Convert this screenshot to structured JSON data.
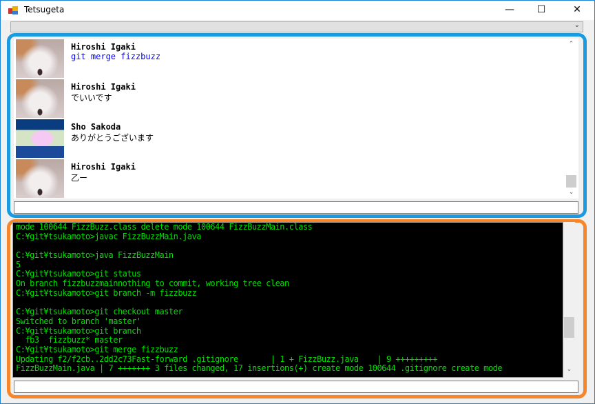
{
  "window": {
    "title": "Tetsugeta",
    "minimize": "—",
    "maximize": "☐",
    "close": "✕"
  },
  "combo": {
    "value": "",
    "chevron": "⌄"
  },
  "chat": {
    "messages": [
      {
        "name": "Hiroshi Igaki",
        "text": "git merge fizzbuzz",
        "avatar": "dog-photo"
      },
      {
        "name": "Hiroshi Igaki",
        "text": "でいいです",
        "avatar": "dog-photo"
      },
      {
        "name": "Sho Sakoda",
        "text": "ありがとうございます",
        "avatar": "pixel-character"
      },
      {
        "name": "Hiroshi Igaki",
        "text": "乙ー",
        "avatar": "dog-photo"
      }
    ],
    "scroll_up": "⌃",
    "scroll_down": "⌄"
  },
  "chat_input": {
    "value": ""
  },
  "console": {
    "lines": [
      "mode 100644 FizzBuzz.class delete mode 100644 FizzBuzzMain.class",
      "C:¥git¥tsukamoto>javac FizzBuzzMain.java",
      "",
      "C:¥git¥tsukamoto>java FizzBuzzMain",
      "5",
      "C:¥git¥tsukamoto>git status",
      "On branch fizzbuzzmainnothing to commit, working tree clean",
      "C:¥git¥tsukamoto>git branch -m fizzbuzz",
      "",
      "C:¥git¥tsukamoto>git checkout master",
      "Switched to branch 'master'",
      "C:¥git¥tsukamoto>git branch",
      "  fb3  fizzbuzz* master",
      "C:¥git¥tsukamoto>git merge fizzbuzz",
      "Updating f2/f2cb..2dd2c73Fast-forward .gitignore       | 1 + FizzBuzz.java    | 9 +++++++++",
      "FizzBuzzMain.java | 7 +++++++ 3 files changed, 17 insertions(+) create mode 100644 .gitignore create mode"
    ],
    "scroll_down": "⌄"
  },
  "console_input": {
    "value": ""
  },
  "colors": {
    "chat_frame": "#1a9be0",
    "console_frame": "#f7862a",
    "console_text": "#00e000",
    "link_text": "#0000ff"
  }
}
